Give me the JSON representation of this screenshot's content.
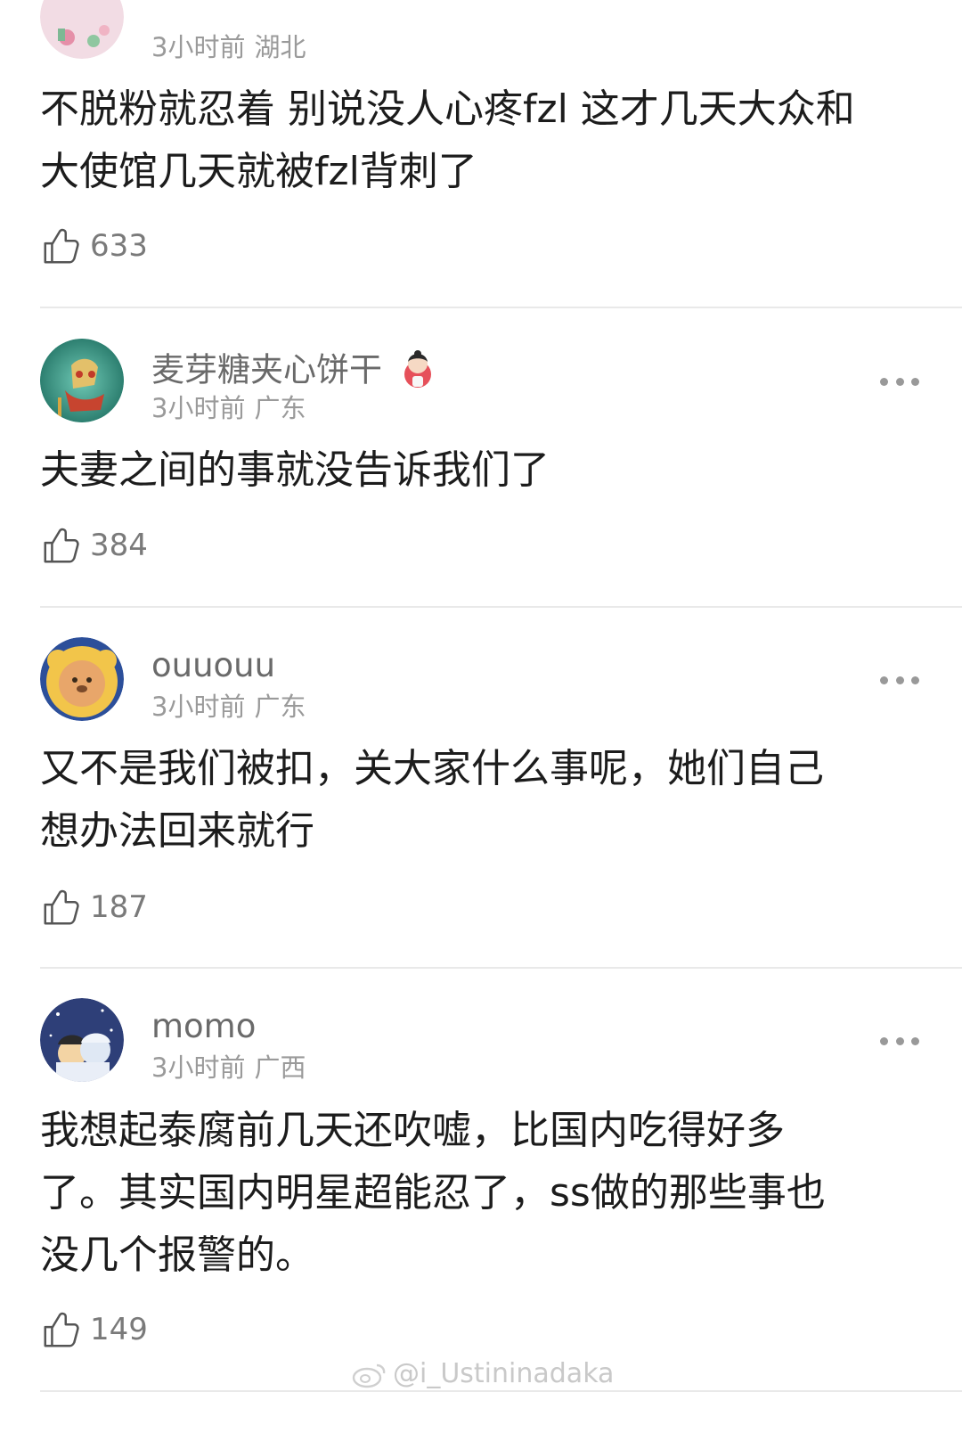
{
  "comments": [
    {
      "username": "",
      "time": "3小时前",
      "location": "湖北",
      "text": "不脱粉就忍着 别说没人心疼fzl 这才几天大众和\n大使馆几天就被fzl背刺了",
      "likes": "633"
    },
    {
      "username": "麦芽糖夹心饼干",
      "time": "3小时前",
      "location": "广东",
      "text": "夫妻之间的事就没告诉我们了",
      "likes": "384"
    },
    {
      "username": "ouuouu",
      "time": "3小时前",
      "location": "广东",
      "text": "又不是我们被扣，关大家什么事呢，她们自己\n想办法回来就行",
      "likes": "187"
    },
    {
      "username": "momo",
      "time": "3小时前",
      "location": "广西",
      "text": "我想起泰腐前几天还吹嘘，比国内吃得好多\n了。其实国内明星超能忍了，ss做的那些事也\n没几个报警的。",
      "likes": "149"
    }
  ],
  "watermark": "@i_Ustininadaka",
  "icons": {
    "like": "thumbs-up-icon",
    "more": "more-dots-icon",
    "weibo": "weibo-logo-icon"
  },
  "colors": {
    "text": "#1c1c1c",
    "username": "#6a6a6a",
    "meta": "#9a9a9a",
    "divider": "#e9e9e9",
    "background": "#ffffff"
  }
}
